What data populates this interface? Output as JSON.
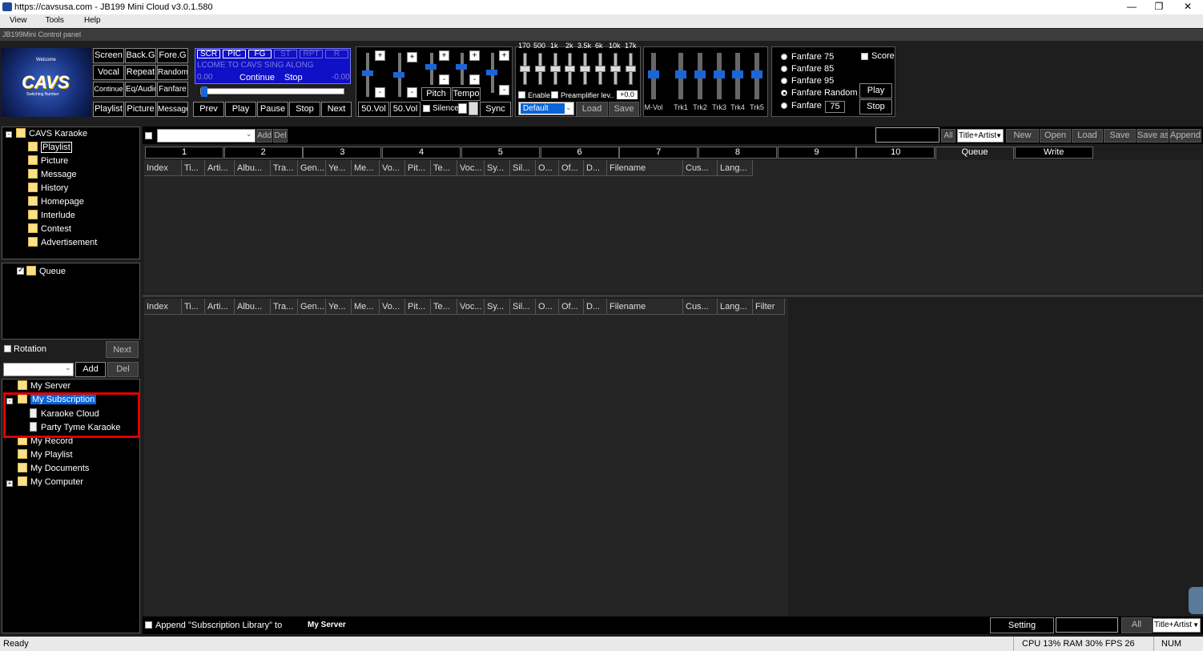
{
  "window": {
    "title": "https://cavsusa.com - JB199 Mini Cloud v3.0.1.580"
  },
  "menu": [
    "View",
    "Tools",
    "Help"
  ],
  "control_panel": {
    "title": "JB199Mini Control panel"
  },
  "logo": {
    "line1": "Welcome",
    "line2": "CAVS",
    "line3": "Switching Number"
  },
  "mode_buttons": [
    "Screen",
    "Back.G",
    "Fore.G",
    "Vocal",
    "Repeat",
    "Random",
    "Continue",
    "Eq/Audio",
    "Fanfare",
    "Playlist",
    "Picture",
    "Message"
  ],
  "lcd": {
    "tags": [
      "SCR",
      "PIC",
      "FG",
      "ST",
      "RPT",
      "R"
    ],
    "marquee": "LCOME TO CAVS SING ALONG",
    "time_left": "0.00",
    "time_right": "-0.00",
    "mode": "Continue",
    "state": "Stop"
  },
  "transport": [
    "Prev",
    "Play",
    "Pause",
    "Stop",
    "Next"
  ],
  "volume": {
    "left_label": "50.Vol",
    "right_label": "50.Vol"
  },
  "pitch_tempo": {
    "pitch": "Pitch",
    "tempo": "Tempo",
    "silence": "Silence",
    "sync": "Sync"
  },
  "equalizer": {
    "bands": [
      "170",
      "500",
      "1k",
      "2k",
      "3.5k",
      "6k",
      "10k",
      "17k"
    ],
    "enable": "Enable",
    "preamp": "Preamplifier lev..",
    "preamp_value": "+0.0",
    "preset": "Default",
    "load": "Load",
    "save": "Save"
  },
  "mixer": {
    "channels": [
      "M-Vol",
      "Trk1",
      "Trk2",
      "Trk3",
      "Trk4",
      "Trk5"
    ]
  },
  "fanfare": {
    "options": [
      "Fanfare 75",
      "Fanfare 85",
      "Fanfare 95",
      "Fanfare Random",
      "Fanfare"
    ],
    "custom_value": "75",
    "score": "Score",
    "play": "Play",
    "stop": "Stop"
  },
  "tree_top": {
    "root": "CAVS Karaoke",
    "items": [
      "Playlist",
      "Picture",
      "Message",
      "History",
      "Homepage",
      "Interlude",
      "Contest",
      "Advertisement"
    ]
  },
  "queue_panel": {
    "item": "Queue",
    "rotation": "Rotation",
    "next": "Next",
    "add": "Add",
    "del": "Del"
  },
  "tree_bottom": {
    "items": [
      "My Server",
      "My Subscription",
      "Karaoke Cloud",
      "Party Tyme Karaoke",
      "My Record",
      "My Playlist",
      "My Documents",
      "My Computer"
    ]
  },
  "playlist_toolbar": {
    "add": "Add",
    "del": "Del",
    "all": "All",
    "search_mode": "Title+Artist",
    "buttons": [
      "New",
      "Open",
      "Load",
      "Save",
      "Save as",
      "Append"
    ]
  },
  "tabs": [
    "1",
    "2",
    "3",
    "4",
    "5",
    "6",
    "7",
    "8",
    "9",
    "10",
    "Queue",
    "Write"
  ],
  "columns": [
    "Index",
    "Ti...",
    "Arti...",
    "Albu...",
    "Tra...",
    "Gen...",
    "Ye...",
    "Me...",
    "Vo...",
    "Pit...",
    "Te...",
    "Voc...",
    "Sy...",
    "Sil...",
    "O...",
    "Of...",
    "D...",
    "Filename",
    "Cus...",
    "Lang..."
  ],
  "lower_extra_column": "Filter",
  "bottom_bar": {
    "append_text": "Append \"Subscription Library\" to",
    "target": "My Server",
    "setting": "Setting",
    "all": "All",
    "search_mode": "Title+Artist"
  },
  "status": {
    "left": "Ready",
    "stats": "CPU 13% RAM 30% FPS 26",
    "num": "NUM"
  },
  "colors": {
    "accent": "#1a66d8",
    "lcd": "#1010c8",
    "highlight": "#e00000",
    "selected": "#0a64d8"
  }
}
